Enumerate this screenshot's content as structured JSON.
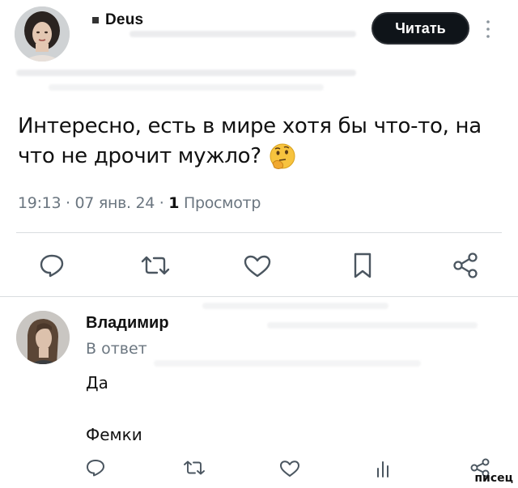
{
  "post": {
    "author": "Deus",
    "read_button": "Читать",
    "text": "Интересно, есть в мире хотя бы что-то, на что не дрочит мужло? 🤔",
    "text_line1": "Интересно, есть в мире хотя бы что-то, на",
    "text_line2": "что не дрочит мужло?",
    "time": "19:13",
    "sep1": "·",
    "date": "07 янв. 24",
    "sep2": "·",
    "views_count": "1",
    "views_label": "Просмотр"
  },
  "reply": {
    "author": "Владимир",
    "subtitle": "В ответ",
    "line1": "Да",
    "line2": "Фемки"
  },
  "watermark": "писец",
  "icons": {
    "more": "more-vertical-icon",
    "reply": "reply-icon",
    "repost": "repost-icon",
    "like": "heart-icon",
    "bookmark": "bookmark-icon",
    "share": "share-icon",
    "views": "views-icon",
    "thinking": "thinking-face-emoji"
  },
  "colors": {
    "button_bg": "#0f1419",
    "meta_text": "#6b7680",
    "icon_stroke": "#4b5660",
    "divider": "#d9dde0"
  }
}
